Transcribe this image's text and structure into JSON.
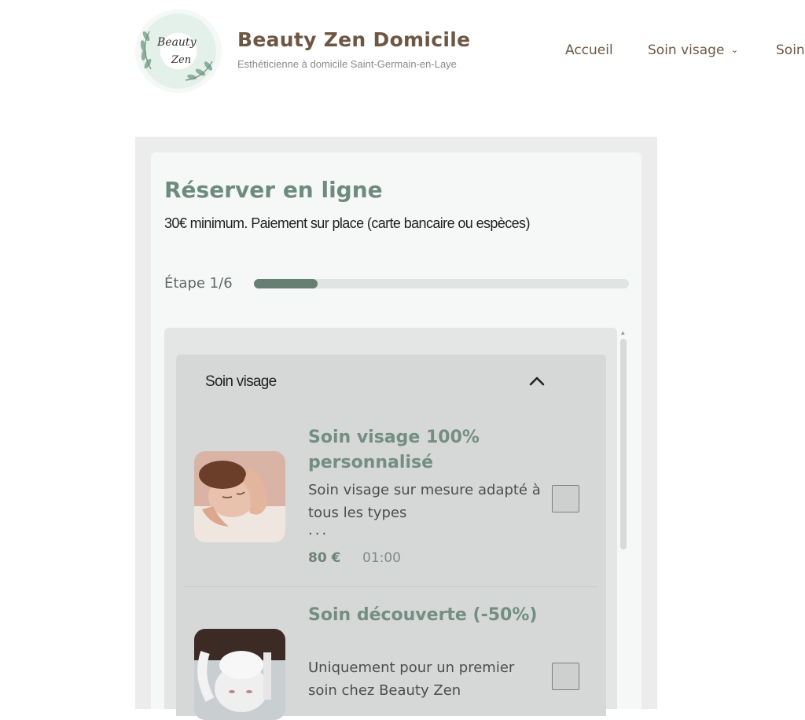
{
  "header": {
    "logo_text_top": "Beauty",
    "logo_text_bottom": "Zen",
    "site_title": "Beauty Zen Domicile",
    "tagline": "Esthéticienne à domicile Saint-Germain-en-Laye",
    "nav": {
      "home": "Accueil",
      "face_care": "Soin visage",
      "face_care_chevron": "⌄",
      "next_partial": "Soin"
    }
  },
  "booking": {
    "title": "Réserver en ligne",
    "subtitle": "30€ minimum. Paiement sur place (carte bancaire ou espèces)",
    "step_label": "Étape 1/6",
    "progress": 0.17,
    "category": {
      "title": "Soin visage",
      "expanded": true,
      "chevron_icon": "chevron-up-icon"
    },
    "services": [
      {
        "name": "Soin visage 100% personnalisé",
        "description": "Soin visage sur mesure adapté à tous les types",
        "more": "...",
        "price": "80 €",
        "duration": "01:00",
        "checked": false
      },
      {
        "name": "Soin découverte (-50%)",
        "description": "Uniquement pour un premier soin chez Beauty Zen",
        "checked": false
      }
    ]
  },
  "colors": {
    "brand_brown": "#6d5744",
    "sage_green": "#6e8b7f",
    "progress_fill": "#677f73"
  }
}
